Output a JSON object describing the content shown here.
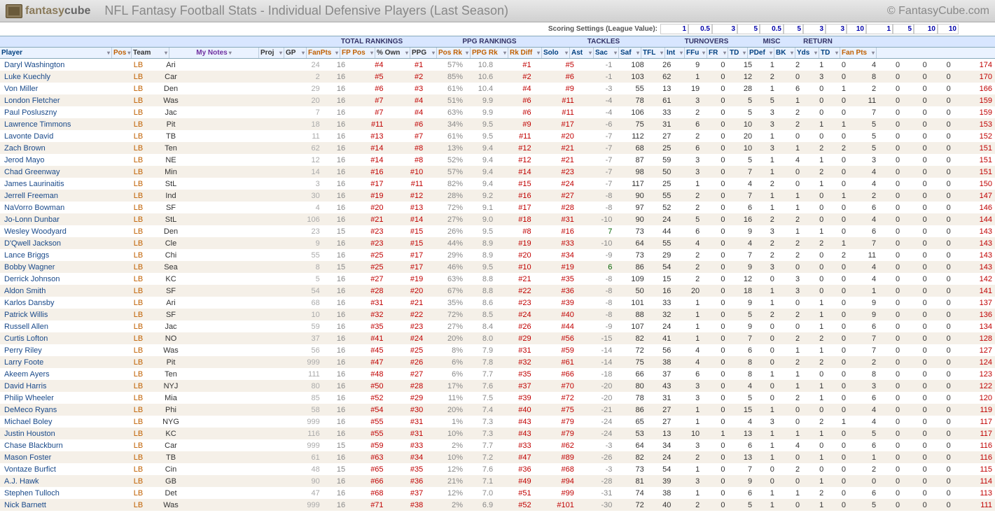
{
  "logo": {
    "fantasy": "fantasy",
    "cube": "cube"
  },
  "page_title": "NFL Fantasy Football Stats - Individual Defensive Players (Last Season)",
  "site_credit": "© FantasyCube.com",
  "scoring": {
    "label": "Scoring Settings (League Value):",
    "values": [
      "1",
      "0.5",
      "3",
      "5",
      "0.5",
      "5",
      "3",
      "3",
      "10",
      "1",
      "5",
      "10",
      "10"
    ]
  },
  "groups": {
    "total": "TOTAL RANKINGS",
    "ppg": "PPG RANKINGS",
    "tackles": "TACKLES",
    "turnovers": "TURNOVERS",
    "misc": "MISC",
    "return": "RETURN"
  },
  "cols": {
    "player": "Player",
    "pos": "Pos",
    "team": "Team",
    "notes": "My Notes",
    "proj": "Proj",
    "gp": "GP",
    "fanpts": "FanPts",
    "fppos": "FP Pos",
    "own": "% Own",
    "ppg": "PPG",
    "posrk": "Pos Rk",
    "ppgrk": "PPG Rk",
    "rkdiff": "Rk Diff",
    "solo": "Solo",
    "ast": "Ast",
    "sac": "Sac",
    "saf": "Saf",
    "tfl": "TFL",
    "int": "Int",
    "ffu": "FFu",
    "fr": "FR",
    "td1": "TD",
    "pdef": "PDef",
    "bk": "BK",
    "yds": "Yds",
    "td2": "TD",
    "fp": "Fan Pts"
  },
  "rows": [
    {
      "player": "Daryl Washington",
      "pos": "LB",
      "team": "Ari",
      "proj": 24,
      "gp": 16,
      "fanpts": "#4",
      "fppos": "#1",
      "own": "57%",
      "ppg": "10.8",
      "posrk": "#1",
      "ppgrk": "#5",
      "rkdiff": -1,
      "solo": 108,
      "ast": 26,
      "sac": 9,
      "saf": 0,
      "tfl": 15,
      "int": 1,
      "ffu": 2,
      "fr": 1,
      "td1": 0,
      "pdef": 4,
      "bk": 0,
      "yds": 0,
      "td2": 0,
      "fp": 174
    },
    {
      "player": "Luke Kuechly",
      "pos": "LB",
      "team": "Car",
      "proj": 2,
      "gp": 16,
      "fanpts": "#5",
      "fppos": "#2",
      "own": "85%",
      "ppg": "10.6",
      "posrk": "#2",
      "ppgrk": "#6",
      "rkdiff": -1,
      "solo": 103,
      "ast": 62,
      "sac": 1,
      "saf": 0,
      "tfl": 12,
      "int": 2,
      "ffu": 0,
      "fr": 3,
      "td1": 0,
      "pdef": 8,
      "bk": 0,
      "yds": 0,
      "td2": 0,
      "fp": 170
    },
    {
      "player": "Von Miller",
      "pos": "LB",
      "team": "Den",
      "proj": 29,
      "gp": 16,
      "fanpts": "#6",
      "fppos": "#3",
      "own": "61%",
      "ppg": "10.4",
      "posrk": "#4",
      "ppgrk": "#9",
      "rkdiff": -3,
      "solo": 55,
      "ast": 13,
      "sac": 19,
      "saf": 0,
      "tfl": 28,
      "int": 1,
      "ffu": 6,
      "fr": 0,
      "td1": 1,
      "pdef": 2,
      "bk": 0,
      "yds": 0,
      "td2": 0,
      "fp": 166
    },
    {
      "player": "London Fletcher",
      "pos": "LB",
      "team": "Was",
      "proj": 20,
      "gp": 16,
      "fanpts": "#7",
      "fppos": "#4",
      "own": "51%",
      "ppg": "9.9",
      "posrk": "#6",
      "ppgrk": "#11",
      "rkdiff": -4,
      "solo": 78,
      "ast": 61,
      "sac": 3,
      "saf": 0,
      "tfl": 5,
      "int": 5,
      "ffu": 1,
      "fr": 0,
      "td1": 0,
      "pdef": 11,
      "bk": 0,
      "yds": 0,
      "td2": 0,
      "fp": 159
    },
    {
      "player": "Paul Posluszny",
      "pos": "LB",
      "team": "Jac",
      "proj": 7,
      "gp": 16,
      "fanpts": "#7",
      "fppos": "#4",
      "own": "63%",
      "ppg": "9.9",
      "posrk": "#6",
      "ppgrk": "#11",
      "rkdiff": -4,
      "solo": 106,
      "ast": 33,
      "sac": 2,
      "saf": 0,
      "tfl": 5,
      "int": 3,
      "ffu": 2,
      "fr": 0,
      "td1": 0,
      "pdef": 7,
      "bk": 0,
      "yds": 0,
      "td2": 0,
      "fp": 159
    },
    {
      "player": "Lawrence Timmons",
      "pos": "LB",
      "team": "Pit",
      "proj": 18,
      "gp": 16,
      "fanpts": "#11",
      "fppos": "#6",
      "own": "34%",
      "ppg": "9.5",
      "posrk": "#9",
      "ppgrk": "#17",
      "rkdiff": -6,
      "solo": 75,
      "ast": 31,
      "sac": 6,
      "saf": 0,
      "tfl": 10,
      "int": 3,
      "ffu": 2,
      "fr": 1,
      "td1": 1,
      "pdef": 5,
      "bk": 0,
      "yds": 0,
      "td2": 0,
      "fp": 153
    },
    {
      "player": "Lavonte David",
      "pos": "LB",
      "team": "TB",
      "proj": 11,
      "gp": 16,
      "fanpts": "#13",
      "fppos": "#7",
      "own": "61%",
      "ppg": "9.5",
      "posrk": "#11",
      "ppgrk": "#20",
      "rkdiff": -7,
      "solo": 112,
      "ast": 27,
      "sac": 2,
      "saf": 0,
      "tfl": 20,
      "int": 1,
      "ffu": 0,
      "fr": 0,
      "td1": 0,
      "pdef": 5,
      "bk": 0,
      "yds": 0,
      "td2": 0,
      "fp": 152
    },
    {
      "player": "Zach Brown",
      "pos": "LB",
      "team": "Ten",
      "proj": 62,
      "gp": 16,
      "fanpts": "#14",
      "fppos": "#8",
      "own": "13%",
      "ppg": "9.4",
      "posrk": "#12",
      "ppgrk": "#21",
      "rkdiff": -7,
      "solo": 68,
      "ast": 25,
      "sac": 6,
      "saf": 0,
      "tfl": 10,
      "int": 3,
      "ffu": 1,
      "fr": 2,
      "td1": 2,
      "pdef": 5,
      "bk": 0,
      "yds": 0,
      "td2": 0,
      "fp": 151
    },
    {
      "player": "Jerod Mayo",
      "pos": "LB",
      "team": "NE",
      "proj": 12,
      "gp": 16,
      "fanpts": "#14",
      "fppos": "#8",
      "own": "52%",
      "ppg": "9.4",
      "posrk": "#12",
      "ppgrk": "#21",
      "rkdiff": -7,
      "solo": 87,
      "ast": 59,
      "sac": 3,
      "saf": 0,
      "tfl": 5,
      "int": 1,
      "ffu": 4,
      "fr": 1,
      "td1": 0,
      "pdef": 3,
      "bk": 0,
      "yds": 0,
      "td2": 0,
      "fp": 151
    },
    {
      "player": "Chad Greenway",
      "pos": "LB",
      "team": "Min",
      "proj": 14,
      "gp": 16,
      "fanpts": "#16",
      "fppos": "#10",
      "own": "57%",
      "ppg": "9.4",
      "posrk": "#14",
      "ppgrk": "#23",
      "rkdiff": -7,
      "solo": 98,
      "ast": 50,
      "sac": 3,
      "saf": 0,
      "tfl": 7,
      "int": 1,
      "ffu": 0,
      "fr": 2,
      "td1": 0,
      "pdef": 4,
      "bk": 0,
      "yds": 0,
      "td2": 0,
      "fp": 151
    },
    {
      "player": "James Laurinaitis",
      "pos": "LB",
      "team": "StL",
      "proj": 3,
      "gp": 16,
      "fanpts": "#17",
      "fppos": "#11",
      "own": "82%",
      "ppg": "9.4",
      "posrk": "#15",
      "ppgrk": "#24",
      "rkdiff": -7,
      "solo": 117,
      "ast": 25,
      "sac": 1,
      "saf": 0,
      "tfl": 4,
      "int": 2,
      "ffu": 0,
      "fr": 1,
      "td1": 0,
      "pdef": 4,
      "bk": 0,
      "yds": 0,
      "td2": 0,
      "fp": 150
    },
    {
      "player": "Jerrell Freeman",
      "pos": "LB",
      "team": "Ind",
      "proj": 30,
      "gp": 16,
      "fanpts": "#19",
      "fppos": "#12",
      "own": "28%",
      "ppg": "9.2",
      "posrk": "#16",
      "ppgrk": "#27",
      "rkdiff": -8,
      "solo": 90,
      "ast": 55,
      "sac": 2,
      "saf": 0,
      "tfl": 7,
      "int": 1,
      "ffu": 1,
      "fr": 0,
      "td1": 1,
      "pdef": 2,
      "bk": 0,
      "yds": 0,
      "td2": 0,
      "fp": 147
    },
    {
      "player": "NaVorro Bowman",
      "pos": "LB",
      "team": "SF",
      "proj": 4,
      "gp": 16,
      "fanpts": "#20",
      "fppos": "#13",
      "own": "72%",
      "ppg": "9.1",
      "posrk": "#17",
      "ppgrk": "#28",
      "rkdiff": -8,
      "solo": 97,
      "ast": 52,
      "sac": 2,
      "saf": 0,
      "tfl": 6,
      "int": 1,
      "ffu": 1,
      "fr": 0,
      "td1": 0,
      "pdef": 6,
      "bk": 0,
      "yds": 0,
      "td2": 0,
      "fp": 146
    },
    {
      "player": "Jo-Lonn Dunbar",
      "pos": "LB",
      "team": "StL",
      "proj": 106,
      "gp": 16,
      "fanpts": "#21",
      "fppos": "#14",
      "own": "27%",
      "ppg": "9.0",
      "posrk": "#18",
      "ppgrk": "#31",
      "rkdiff": -10,
      "solo": 90,
      "ast": 24,
      "sac": 5,
      "saf": 0,
      "tfl": 16,
      "int": 2,
      "ffu": 2,
      "fr": 0,
      "td1": 0,
      "pdef": 4,
      "bk": 0,
      "yds": 0,
      "td2": 0,
      "fp": 144
    },
    {
      "player": "Wesley Woodyard",
      "pos": "LB",
      "team": "Den",
      "proj": 23,
      "gp": 15,
      "fanpts": "#23",
      "fppos": "#15",
      "own": "26%",
      "ppg": "9.5",
      "posrk": "#8",
      "ppgrk": "#16",
      "rkdiff": 7,
      "solo": 73,
      "ast": 44,
      "sac": 6,
      "saf": 0,
      "tfl": 9,
      "int": 3,
      "ffu": 1,
      "fr": 1,
      "td1": 0,
      "pdef": 6,
      "bk": 0,
      "yds": 0,
      "td2": 0,
      "fp": 143
    },
    {
      "player": "D'Qwell Jackson",
      "pos": "LB",
      "team": "Cle",
      "proj": 9,
      "gp": 16,
      "fanpts": "#23",
      "fppos": "#15",
      "own": "44%",
      "ppg": "8.9",
      "posrk": "#19",
      "ppgrk": "#33",
      "rkdiff": -10,
      "solo": 64,
      "ast": 55,
      "sac": 4,
      "saf": 0,
      "tfl": 4,
      "int": 2,
      "ffu": 2,
      "fr": 2,
      "td1": 1,
      "pdef": 7,
      "bk": 0,
      "yds": 0,
      "td2": 0,
      "fp": 143
    },
    {
      "player": "Lance Briggs",
      "pos": "LB",
      "team": "Chi",
      "proj": 55,
      "gp": 16,
      "fanpts": "#25",
      "fppos": "#17",
      "own": "29%",
      "ppg": "8.9",
      "posrk": "#20",
      "ppgrk": "#34",
      "rkdiff": -9,
      "solo": 73,
      "ast": 29,
      "sac": 2,
      "saf": 0,
      "tfl": 7,
      "int": 2,
      "ffu": 2,
      "fr": 0,
      "td1": 2,
      "pdef": 11,
      "bk": 0,
      "yds": 0,
      "td2": 0,
      "fp": 143
    },
    {
      "player": "Bobby Wagner",
      "pos": "LB",
      "team": "Sea",
      "proj": 8,
      "gp": 15,
      "fanpts": "#25",
      "fppos": "#17",
      "own": "46%",
      "ppg": "9.5",
      "posrk": "#10",
      "ppgrk": "#19",
      "rkdiff": 6,
      "solo": 86,
      "ast": 54,
      "sac": 2,
      "saf": 0,
      "tfl": 9,
      "int": 3,
      "ffu": 0,
      "fr": 0,
      "td1": 0,
      "pdef": 4,
      "bk": 0,
      "yds": 0,
      "td2": 0,
      "fp": 143
    },
    {
      "player": "Derrick Johnson",
      "pos": "LB",
      "team": "KC",
      "proj": 5,
      "gp": 16,
      "fanpts": "#27",
      "fppos": "#19",
      "own": "63%",
      "ppg": "8.8",
      "posrk": "#21",
      "ppgrk": "#35",
      "rkdiff": -8,
      "solo": 109,
      "ast": 15,
      "sac": 2,
      "saf": 0,
      "tfl": 12,
      "int": 0,
      "ffu": 3,
      "fr": 0,
      "td1": 0,
      "pdef": 4,
      "bk": 0,
      "yds": 0,
      "td2": 0,
      "fp": 142
    },
    {
      "player": "Aldon Smith",
      "pos": "LB",
      "team": "SF",
      "proj": 54,
      "gp": 16,
      "fanpts": "#28",
      "fppos": "#20",
      "own": "67%",
      "ppg": "8.8",
      "posrk": "#22",
      "ppgrk": "#36",
      "rkdiff": -8,
      "solo": 50,
      "ast": 16,
      "sac": 20,
      "saf": 0,
      "tfl": 18,
      "int": 1,
      "ffu": 3,
      "fr": 0,
      "td1": 0,
      "pdef": 1,
      "bk": 0,
      "yds": 0,
      "td2": 0,
      "fp": 141
    },
    {
      "player": "Karlos Dansby",
      "pos": "LB",
      "team": "Ari",
      "proj": 68,
      "gp": 16,
      "fanpts": "#31",
      "fppos": "#21",
      "own": "35%",
      "ppg": "8.6",
      "posrk": "#23",
      "ppgrk": "#39",
      "rkdiff": -8,
      "solo": 101,
      "ast": 33,
      "sac": 1,
      "saf": 0,
      "tfl": 9,
      "int": 1,
      "ffu": 0,
      "fr": 1,
      "td1": 0,
      "pdef": 9,
      "bk": 0,
      "yds": 0,
      "td2": 0,
      "fp": 137
    },
    {
      "player": "Patrick Willis",
      "pos": "LB",
      "team": "SF",
      "proj": 10,
      "gp": 16,
      "fanpts": "#32",
      "fppos": "#22",
      "own": "72%",
      "ppg": "8.5",
      "posrk": "#24",
      "ppgrk": "#40",
      "rkdiff": -8,
      "solo": 88,
      "ast": 32,
      "sac": 1,
      "saf": 0,
      "tfl": 5,
      "int": 2,
      "ffu": 2,
      "fr": 1,
      "td1": 0,
      "pdef": 9,
      "bk": 0,
      "yds": 0,
      "td2": 0,
      "fp": 136
    },
    {
      "player": "Russell Allen",
      "pos": "LB",
      "team": "Jac",
      "proj": 59,
      "gp": 16,
      "fanpts": "#35",
      "fppos": "#23",
      "own": "27%",
      "ppg": "8.4",
      "posrk": "#26",
      "ppgrk": "#44",
      "rkdiff": -9,
      "solo": 107,
      "ast": 24,
      "sac": 1,
      "saf": 0,
      "tfl": 9,
      "int": 0,
      "ffu": 0,
      "fr": 1,
      "td1": 0,
      "pdef": 6,
      "bk": 0,
      "yds": 0,
      "td2": 0,
      "fp": 134
    },
    {
      "player": "Curtis Lofton",
      "pos": "LB",
      "team": "NO",
      "proj": 37,
      "gp": 16,
      "fanpts": "#41",
      "fppos": "#24",
      "own": "20%",
      "ppg": "8.0",
      "posrk": "#29",
      "ppgrk": "#56",
      "rkdiff": -15,
      "solo": 82,
      "ast": 41,
      "sac": 1,
      "saf": 0,
      "tfl": 7,
      "int": 0,
      "ffu": 2,
      "fr": 2,
      "td1": 0,
      "pdef": 7,
      "bk": 0,
      "yds": 0,
      "td2": 0,
      "fp": 128
    },
    {
      "player": "Perry Riley",
      "pos": "LB",
      "team": "Was",
      "proj": 56,
      "gp": 16,
      "fanpts": "#45",
      "fppos": "#25",
      "own": "8%",
      "ppg": "7.9",
      "posrk": "#31",
      "ppgrk": "#59",
      "rkdiff": -14,
      "solo": 72,
      "ast": 56,
      "sac": 4,
      "saf": 0,
      "tfl": 6,
      "int": 0,
      "ffu": 1,
      "fr": 1,
      "td1": 0,
      "pdef": 7,
      "bk": 0,
      "yds": 0,
      "td2": 0,
      "fp": 127
    },
    {
      "player": "Larry Foote",
      "pos": "LB",
      "team": "Pit",
      "proj": 999,
      "gp": 16,
      "fanpts": "#47",
      "fppos": "#26",
      "own": "6%",
      "ppg": "7.8",
      "posrk": "#32",
      "ppgrk": "#61",
      "rkdiff": -14,
      "solo": 75,
      "ast": 38,
      "sac": 4,
      "saf": 0,
      "tfl": 8,
      "int": 0,
      "ffu": 2,
      "fr": 2,
      "td1": 0,
      "pdef": 2,
      "bk": 0,
      "yds": 0,
      "td2": 0,
      "fp": 124
    },
    {
      "player": "Akeem Ayers",
      "pos": "LB",
      "team": "Ten",
      "proj": 111,
      "gp": 16,
      "fanpts": "#48",
      "fppos": "#27",
      "own": "6%",
      "ppg": "7.7",
      "posrk": "#35",
      "ppgrk": "#66",
      "rkdiff": -18,
      "solo": 66,
      "ast": 37,
      "sac": 6,
      "saf": 0,
      "tfl": 8,
      "int": 1,
      "ffu": 1,
      "fr": 0,
      "td1": 0,
      "pdef": 8,
      "bk": 0,
      "yds": 0,
      "td2": 0,
      "fp": 123
    },
    {
      "player": "David Harris",
      "pos": "LB",
      "team": "NYJ",
      "proj": 80,
      "gp": 16,
      "fanpts": "#50",
      "fppos": "#28",
      "own": "17%",
      "ppg": "7.6",
      "posrk": "#37",
      "ppgrk": "#70",
      "rkdiff": -20,
      "solo": 80,
      "ast": 43,
      "sac": 3,
      "saf": 0,
      "tfl": 4,
      "int": 0,
      "ffu": 1,
      "fr": 1,
      "td1": 0,
      "pdef": 3,
      "bk": 0,
      "yds": 0,
      "td2": 0,
      "fp": 122
    },
    {
      "player": "Philip Wheeler",
      "pos": "LB",
      "team": "Mia",
      "proj": 85,
      "gp": 16,
      "fanpts": "#52",
      "fppos": "#29",
      "own": "11%",
      "ppg": "7.5",
      "posrk": "#39",
      "ppgrk": "#72",
      "rkdiff": -20,
      "solo": 78,
      "ast": 31,
      "sac": 3,
      "saf": 0,
      "tfl": 5,
      "int": 0,
      "ffu": 2,
      "fr": 1,
      "td1": 0,
      "pdef": 6,
      "bk": 0,
      "yds": 0,
      "td2": 0,
      "fp": 120
    },
    {
      "player": "DeMeco Ryans",
      "pos": "LB",
      "team": "Phi",
      "proj": 58,
      "gp": 16,
      "fanpts": "#54",
      "fppos": "#30",
      "own": "20%",
      "ppg": "7.4",
      "posrk": "#40",
      "ppgrk": "#75",
      "rkdiff": -21,
      "solo": 86,
      "ast": 27,
      "sac": 1,
      "saf": 0,
      "tfl": 15,
      "int": 1,
      "ffu": 0,
      "fr": 0,
      "td1": 0,
      "pdef": 4,
      "bk": 0,
      "yds": 0,
      "td2": 0,
      "fp": 119
    },
    {
      "player": "Michael Boley",
      "pos": "LB",
      "team": "NYG",
      "proj": 999,
      "gp": 16,
      "fanpts": "#55",
      "fppos": "#31",
      "own": "1%",
      "ppg": "7.3",
      "posrk": "#43",
      "ppgrk": "#79",
      "rkdiff": -24,
      "solo": 65,
      "ast": 27,
      "sac": 1,
      "saf": 0,
      "tfl": 4,
      "int": 3,
      "ffu": 0,
      "fr": 2,
      "td1": 1,
      "pdef": 4,
      "bk": 0,
      "yds": 0,
      "td2": 0,
      "fp": 117
    },
    {
      "player": "Justin Houston",
      "pos": "LB",
      "team": "KC",
      "proj": 116,
      "gp": 16,
      "fanpts": "#55",
      "fppos": "#31",
      "own": "10%",
      "ppg": "7.3",
      "posrk": "#43",
      "ppgrk": "#79",
      "rkdiff": -24,
      "solo": 53,
      "ast": 13,
      "sac": 10,
      "saf": 1,
      "tfl": 13,
      "int": 1,
      "ffu": 1,
      "fr": 1,
      "td1": 0,
      "pdef": 5,
      "bk": 0,
      "yds": 0,
      "td2": 0,
      "fp": 117
    },
    {
      "player": "Chase Blackburn",
      "pos": "LB",
      "team": "Car",
      "proj": 999,
      "gp": 15,
      "fanpts": "#59",
      "fppos": "#33",
      "own": "2%",
      "ppg": "7.7",
      "posrk": "#33",
      "ppgrk": "#62",
      "rkdiff": -3,
      "solo": 64,
      "ast": 34,
      "sac": 3,
      "saf": 0,
      "tfl": 6,
      "int": 1,
      "ffu": 4,
      "fr": 0,
      "td1": 0,
      "pdef": 6,
      "bk": 0,
      "yds": 0,
      "td2": 0,
      "fp": 116
    },
    {
      "player": "Mason Foster",
      "pos": "LB",
      "team": "TB",
      "proj": 61,
      "gp": 16,
      "fanpts": "#63",
      "fppos": "#34",
      "own": "10%",
      "ppg": "7.2",
      "posrk": "#47",
      "ppgrk": "#89",
      "rkdiff": -26,
      "solo": 82,
      "ast": 24,
      "sac": 2,
      "saf": 0,
      "tfl": 13,
      "int": 1,
      "ffu": 0,
      "fr": 1,
      "td1": 0,
      "pdef": 1,
      "bk": 0,
      "yds": 0,
      "td2": 0,
      "fp": 116
    },
    {
      "player": "Vontaze Burfict",
      "pos": "LB",
      "team": "Cin",
      "proj": 48,
      "gp": 15,
      "fanpts": "#65",
      "fppos": "#35",
      "own": "12%",
      "ppg": "7.6",
      "posrk": "#36",
      "ppgrk": "#68",
      "rkdiff": -3,
      "solo": 73,
      "ast": 54,
      "sac": 1,
      "saf": 0,
      "tfl": 7,
      "int": 0,
      "ffu": 2,
      "fr": 0,
      "td1": 0,
      "pdef": 2,
      "bk": 0,
      "yds": 0,
      "td2": 0,
      "fp": 115
    },
    {
      "player": "A.J. Hawk",
      "pos": "LB",
      "team": "GB",
      "proj": 90,
      "gp": 16,
      "fanpts": "#66",
      "fppos": "#36",
      "own": "21%",
      "ppg": "7.1",
      "posrk": "#49",
      "ppgrk": "#94",
      "rkdiff": -28,
      "solo": 81,
      "ast": 39,
      "sac": 3,
      "saf": 0,
      "tfl": 9,
      "int": 0,
      "ffu": 0,
      "fr": 1,
      "td1": 0,
      "pdef": 0,
      "bk": 0,
      "yds": 0,
      "td2": 0,
      "fp": 114
    },
    {
      "player": "Stephen Tulloch",
      "pos": "LB",
      "team": "Det",
      "proj": 47,
      "gp": 16,
      "fanpts": "#68",
      "fppos": "#37",
      "own": "12%",
      "ppg": "7.0",
      "posrk": "#51",
      "ppgrk": "#99",
      "rkdiff": -31,
      "solo": 74,
      "ast": 38,
      "sac": 1,
      "saf": 0,
      "tfl": 6,
      "int": 1,
      "ffu": 1,
      "fr": 2,
      "td1": 0,
      "pdef": 6,
      "bk": 0,
      "yds": 0,
      "td2": 0,
      "fp": 113
    },
    {
      "player": "Nick Barnett",
      "pos": "LB",
      "team": "Was",
      "proj": 999,
      "gp": 16,
      "fanpts": "#71",
      "fppos": "#38",
      "own": "2%",
      "ppg": "6.9",
      "posrk": "#52",
      "ppgrk": "#101",
      "rkdiff": -30,
      "solo": 72,
      "ast": 40,
      "sac": 2,
      "saf": 0,
      "tfl": 5,
      "int": 1,
      "ffu": 0,
      "fr": 1,
      "td1": 0,
      "pdef": 5,
      "bk": 0,
      "yds": 0,
      "td2": 0,
      "fp": 111
    }
  ]
}
